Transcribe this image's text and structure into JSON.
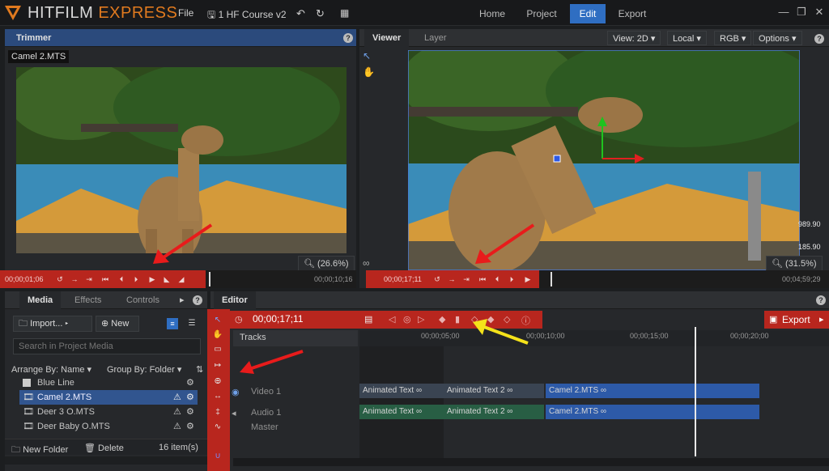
{
  "app": {
    "brand_main": "HITFILM",
    "brand_accent": "EXPRESS",
    "project_name": "1 HF Course v2",
    "menu": {
      "file": "File"
    },
    "top_tabs": [
      {
        "label": "Home"
      },
      {
        "label": "Project"
      },
      {
        "label": "Edit"
      },
      {
        "label": "Export"
      }
    ],
    "active_tab": "Edit",
    "accent_color": "#2f6ec2",
    "highlight_color": "#b8261e"
  },
  "trimmer": {
    "title": "Trimmer",
    "clip_name": "Camel 2.MTS",
    "zoom": "(26.6%)",
    "timecode_current": "00;00;01;06",
    "timecode_end": "00;00;10;16"
  },
  "viewer": {
    "tabs": [
      "Viewer",
      "Layer"
    ],
    "view_mode": "View: 2D",
    "space": "Local",
    "channel": "RGB",
    "options": "Options",
    "readout_1": "989.90",
    "readout_2": "185.90",
    "zoom": "(31.5%)",
    "timecode_current": "00;00;17;11",
    "timecode_end": "00;04;59;29"
  },
  "media": {
    "tabs": [
      "Media",
      "Effects",
      "Controls"
    ],
    "import_label": "Import...",
    "new_label": "New",
    "search_placeholder": "Search in Project Media",
    "arrange_label": "Arrange By: Name",
    "group_label": "Group By: Folder",
    "items": [
      {
        "name": "Blue Line"
      },
      {
        "name": "Camel 2.MTS"
      },
      {
        "name": "Deer 3 O.MTS"
      },
      {
        "name": "Deer Baby O.MTS"
      }
    ],
    "selected_item": "Camel 2.MTS",
    "new_folder_label": "New Folder",
    "delete_label": "Delete",
    "item_count": "16 item(s)"
  },
  "editor": {
    "title": "Editor",
    "timecode": "00;00;17;11",
    "export_label": "Export",
    "tracks_label": "Tracks",
    "ruler": [
      "00;00;05;00",
      "00;00;10;00",
      "00;00;15;00",
      "00;00;20;00"
    ],
    "tracks": [
      {
        "name": "Video 1"
      },
      {
        "name": "Audio 1"
      },
      {
        "name": "Master"
      }
    ],
    "video_clips": [
      "Animated Text",
      "Animated Text 2",
      "Camel 2.MTS"
    ],
    "audio_clips": [
      "Animated Text",
      "Animated Text 2",
      "Camel 2.MTS"
    ]
  }
}
